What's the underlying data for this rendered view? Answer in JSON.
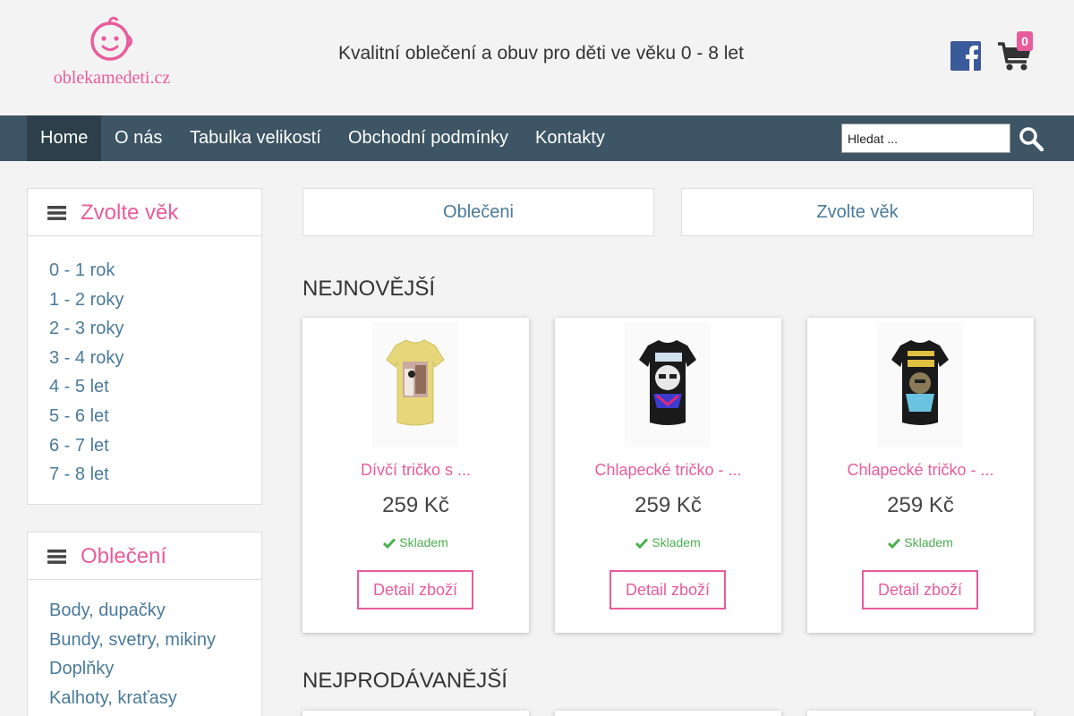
{
  "header": {
    "logo_text": "oblekamedeti.cz",
    "tagline": "Kvalitní oblečení a obuv pro děti ve věku 0 - 8 let",
    "cart_count": "0"
  },
  "nav": {
    "items": [
      "Home",
      "O nás",
      "Tabulka velikostí",
      "Obchodní podmínky",
      "Kontakty"
    ],
    "search_placeholder": "Hledat ..."
  },
  "sidebar": {
    "age_title": "Zvolte věk",
    "age_items": [
      "0 - 1 rok",
      "1 - 2 roky",
      "2 - 3 roky",
      "3 - 4 roky",
      "4 - 5 let",
      "5 - 6 let",
      "6 - 7 let",
      "7 - 8 let"
    ],
    "clothing_title": "Oblečení",
    "clothing_items": [
      "Body, dupačky",
      "Bundy, svetry, mikiny",
      "Doplňky",
      "Kalhoty, kraťasy"
    ]
  },
  "main": {
    "cat_buttons": [
      "Oblečeni",
      "Zvolte věk"
    ],
    "newest_title": "NEJNOVĚJŠÍ",
    "bestselling_title": "NEJPRODÁVANĚJŠÍ",
    "products": [
      {
        "name": "Dívčí tričko s ...",
        "price": "259 Kč",
        "stock": "Skladem",
        "button": "Detail zboží"
      },
      {
        "name": "Chlapecké tričko - ...",
        "price": "259 Kč",
        "stock": "Skladem",
        "button": "Detail zboží"
      },
      {
        "name": "Chlapecké tričko - ...",
        "price": "259 Kč",
        "stock": "Skladem",
        "button": "Detail zboží"
      }
    ]
  },
  "colors": {
    "accent": "#e85c9c",
    "nav_bg": "#3d5564",
    "link": "#4a7a9a",
    "stock": "#4caf50"
  },
  "icons": [
    "baby-face-logo-icon",
    "facebook-icon",
    "cart-icon",
    "search-icon",
    "menu-icon",
    "check-icon"
  ]
}
